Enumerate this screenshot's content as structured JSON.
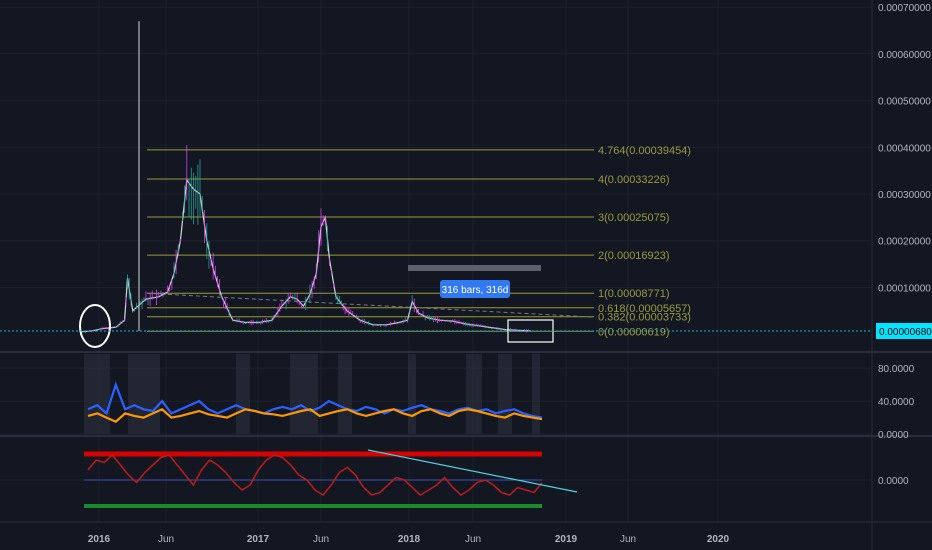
{
  "chart_data": [
    {
      "type": "line",
      "title": "",
      "xlabel": "",
      "ylabel": "",
      "x_ticks": [
        "2016",
        "Jun",
        "2017",
        "Jun",
        "2018",
        "Jun",
        "2019",
        "Jun",
        "2020"
      ],
      "y_ticks": [
        "0.00070000",
        "0.00060000",
        "0.00050000",
        "0.00040000",
        "0.00030000",
        "0.00020000",
        "0.00010000"
      ],
      "ylim": [
        0,
        0.0007
      ],
      "last_price": "0.00000680",
      "series": [
        {
          "dates": [
            "2015-11-20",
            "2015-12-15",
            "2016-01-10",
            "2016-02-10",
            "2016-03-01",
            "2016-03-08",
            "2016-03-20",
            "2016-04-20",
            "2016-05-20",
            "2016-06-10",
            "2016-06-25",
            "2016-07-10",
            "2016-07-25",
            "2016-08-10",
            "2016-08-25",
            "2016-09-10",
            "2016-09-25",
            "2016-10-15",
            "2016-11-10",
            "2016-12-10",
            "2017-01-10",
            "2017-02-10",
            "2017-03-05",
            "2017-03-25",
            "2017-04-10",
            "2017-04-25",
            "2017-05-10",
            "2017-05-25",
            "2017-06-05",
            "2017-06-15",
            "2017-06-25",
            "2017-07-10",
            "2017-08-05",
            "2017-09-05",
            "2017-10-05",
            "2017-11-05",
            "2017-12-05",
            "2017-12-25",
            "2018-01-05",
            "2018-01-20",
            "2018-02-10",
            "2018-03-10",
            "2018-04-10",
            "2018-05-10",
            "2018-06-10",
            "2018-07-10",
            "2018-08-10",
            "2018-09-10",
            "2018-10-10"
          ],
          "values": [
            5e-06,
            7e-06,
            1.2e-05,
            1.5e-05,
            3e-05,
            0.00012,
            5e-05,
            7.5e-05,
            8e-05,
            9e-05,
            0.00013,
            0.0002,
            0.00033,
            0.00031,
            0.0003,
            0.0002,
            0.00014,
            8e-05,
            3e-05,
            2.5e-05,
            2.5e-05,
            3e-05,
            6e-05,
            8e-05,
            7.5e-05,
            6e-05,
            8.5e-05,
            0.00013,
            0.00023,
            0.00025,
            0.00016,
            8e-05,
            5e-05,
            3e-05,
            2e-05,
            2e-05,
            2.5e-05,
            3e-05,
            7e-05,
            4.5e-05,
            3.5e-05,
            3e-05,
            2.8e-05,
            2.2e-05,
            1.8e-05,
            1.4e-05,
            1e-05,
            8e-06,
            7e-06
          ]
        }
      ],
      "annotations": [
        "316 bars, 316d"
      ]
    },
    {
      "type": "line",
      "title": "",
      "y_ticks": [
        "80.0000",
        "40.0000",
        "0.0000"
      ],
      "ylim": [
        0,
        90
      ],
      "series": [
        {
          "color": "#2962ff",
          "values": [
            30,
            35,
            25,
            60,
            30,
            35,
            30,
            28,
            40,
            25,
            30,
            35,
            40,
            30,
            25,
            30,
            35,
            30,
            28,
            25,
            30,
            33,
            30,
            35,
            28,
            32,
            40,
            35,
            30,
            28,
            33,
            30,
            25,
            30,
            28,
            32,
            35,
            30,
            28,
            25,
            30,
            32,
            28,
            30,
            25,
            28,
            30,
            25,
            22,
            20
          ]
        },
        {
          "color": "#ff9800",
          "values": [
            22,
            25,
            20,
            15,
            25,
            22,
            20,
            25,
            30,
            20,
            22,
            25,
            28,
            24,
            22,
            20,
            25,
            30,
            28,
            25,
            24,
            22,
            25,
            28,
            30,
            22,
            25,
            28,
            30,
            25,
            22,
            25,
            28,
            30,
            25,
            22,
            28,
            30,
            25,
            22,
            28,
            30,
            28,
            25,
            22,
            20,
            25,
            22,
            20,
            18
          ]
        }
      ]
    },
    {
      "type": "line",
      "title": "",
      "y_ticks": [
        "0.0000"
      ],
      "series": [
        {
          "color": "#b71c1c",
          "values": [
            20,
            40,
            35,
            50,
            30,
            10,
            -5,
            15,
            30,
            45,
            50,
            30,
            10,
            -10,
            20,
            40,
            30,
            15,
            -5,
            -20,
            -10,
            20,
            40,
            50,
            45,
            30,
            10,
            0,
            -20,
            -30,
            -10,
            15,
            25,
            10,
            -15,
            -30,
            -25,
            -10,
            5,
            0,
            -15,
            -30,
            -20,
            -10,
            5,
            -15,
            -30,
            -20,
            -5,
            0,
            -10,
            -25,
            -30,
            -15,
            -20,
            -25,
            -5
          ]
        }
      ]
    }
  ],
  "fib_levels": [
    {
      "label": "4.764(0.00039454)",
      "color": "#9a9a3a"
    },
    {
      "label": "4(0.00033226)",
      "color": "#9a9a3a"
    },
    {
      "label": "3(0.00025075)",
      "color": "#9a9a3a"
    },
    {
      "label": "2(0.00016923)",
      "color": "#9a9a3a"
    },
    {
      "label": "1(0.00008771)",
      "color": "#9a9a3a"
    },
    {
      "label": "0.618(0.00005657)",
      "color": "#9a9a3a"
    },
    {
      "label": "0.382(0.00003733)",
      "color": "#9a9a3a"
    },
    {
      "label": "0(0.00000619)",
      "color": "#9a9a3a"
    }
  ],
  "colors": {
    "background": "#131722",
    "grid": "#1e222d",
    "price_line": "#00bcd4",
    "tooltip_bg": "#2962ff"
  }
}
